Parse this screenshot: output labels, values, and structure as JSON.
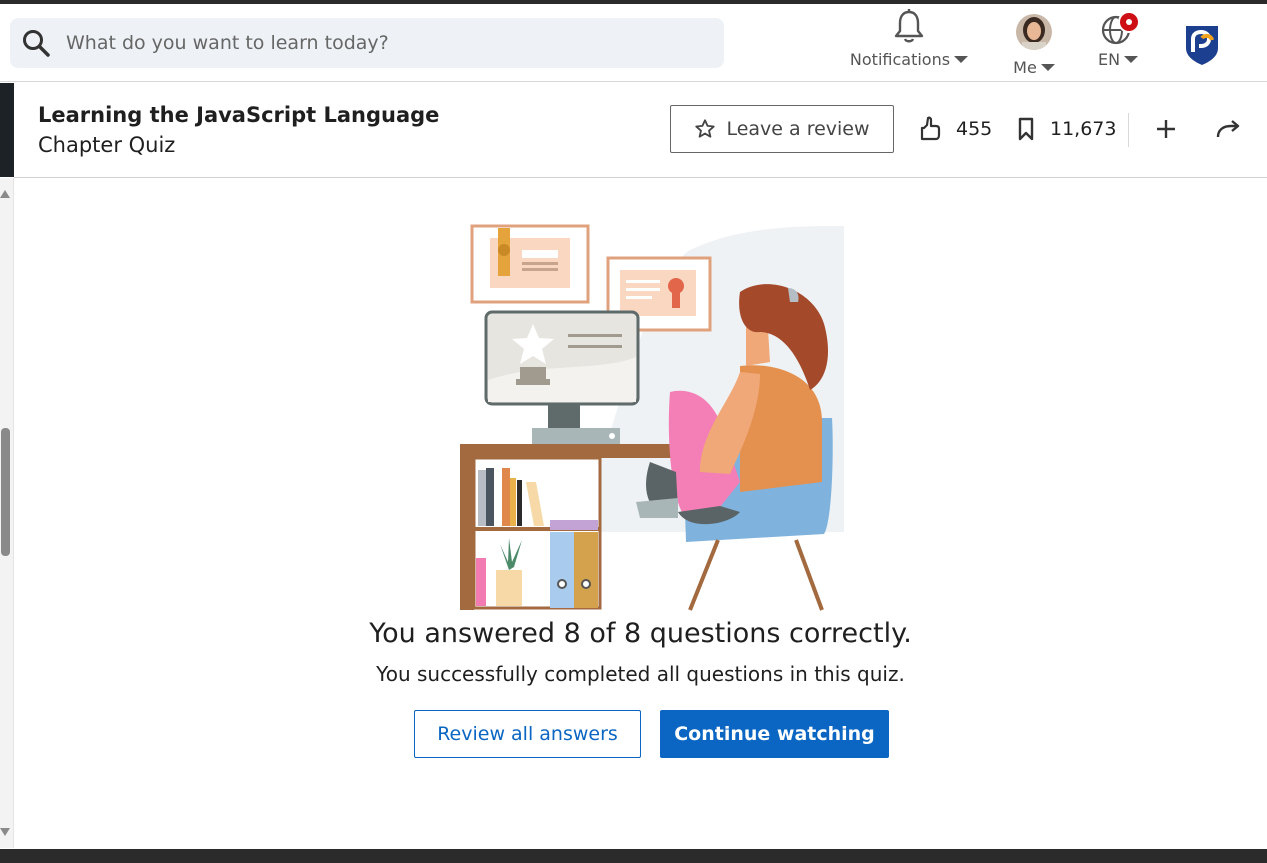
{
  "search": {
    "placeholder": "What do you want to learn today?"
  },
  "nav": {
    "notifications_label": "Notifications",
    "me_label": "Me",
    "language_label": "EN"
  },
  "course": {
    "title": "Learning the JavaScript Language",
    "subtitle": "Chapter Quiz"
  },
  "actions": {
    "review_label": "Leave a review",
    "likes": "455",
    "saves": "11,673"
  },
  "quiz_result": {
    "headline": "You answered 8 of 8 questions correctly.",
    "message": "You successfully completed all questions in this quiz.",
    "review_button": "Review all answers",
    "continue_button": "Continue watching"
  },
  "colors": {
    "accent": "#0a66c2",
    "notification_badge": "#cc1016"
  },
  "icons": [
    "search-icon",
    "bell-icon",
    "globe-icon",
    "org-logo-icon",
    "star-icon",
    "thumbs-up-icon",
    "bookmark-icon",
    "plus-icon",
    "share-icon"
  ]
}
